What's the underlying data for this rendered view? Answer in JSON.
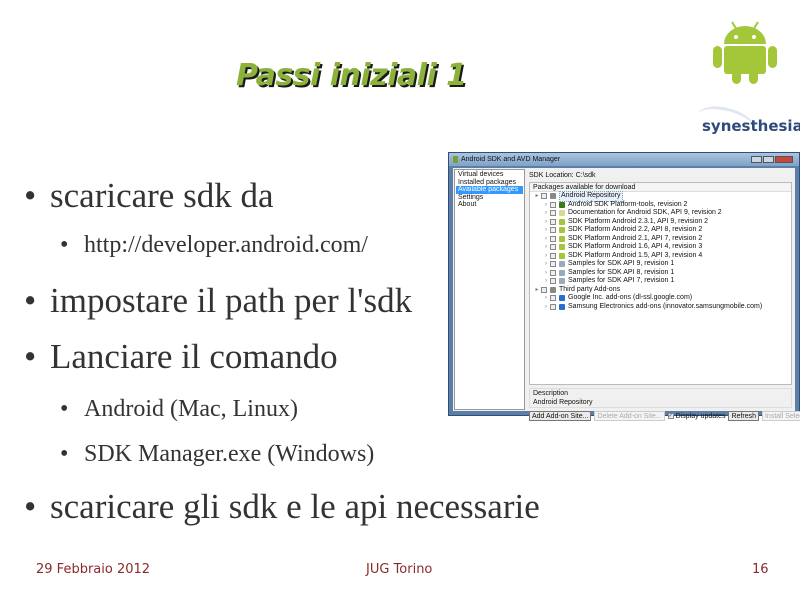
{
  "slide": {
    "title": "Passi iniziali 1",
    "bullets": [
      {
        "level": 1,
        "text": "scaricare sdk da"
      },
      {
        "level": 2,
        "text": "http://developer.android.com/"
      },
      {
        "level": 1,
        "text": "impostare il path per l'sdk"
      },
      {
        "level": 1,
        "text": "Lanciare il comando"
      },
      {
        "level": 2,
        "text": "Android (Mac, Linux)"
      },
      {
        "level": 2,
        "text": "SDK Manager.exe (Windows)"
      },
      {
        "level": 1,
        "text": "scaricare gli sdk e le api necessarie"
      }
    ],
    "bullet_char": "•",
    "footer": {
      "date": "29 Febbraio 2012",
      "event": "JUG Torino",
      "page": "16"
    },
    "logo": {
      "text": "synesthesia",
      "icon": "android-robot-icon",
      "android_color": "#a4c639"
    },
    "title_color": "#8db23c",
    "footer_color": "#8b2a2a"
  },
  "window": {
    "title": "Android SDK and AVD Manager",
    "nav": [
      "Virtual devices",
      "Installed packages",
      "Available packages",
      "Settings",
      "About"
    ],
    "selected_nav": "Available packages",
    "sdk_location": "SDK Location: C:\\sdk",
    "packages_header": "Packages available for download",
    "tree": [
      {
        "level": 0,
        "label": "Android Repository",
        "icon": "repository-icon"
      },
      {
        "level": 1,
        "label": "Android SDK Platform-tools, revision 2",
        "icon": "tools-icon"
      },
      {
        "level": 1,
        "label": "Documentation for Android SDK, API 9, revision 2",
        "icon": "document-icon"
      },
      {
        "level": 1,
        "label": "SDK Platform Android 2.3.1, API 9, revision 2",
        "icon": "android-icon"
      },
      {
        "level": 1,
        "label": "SDK Platform Android 2.2, API 8, revision 2",
        "icon": "android-icon"
      },
      {
        "level": 1,
        "label": "SDK Platform Android 2.1, API 7, revision 2",
        "icon": "android-icon"
      },
      {
        "level": 1,
        "label": "SDK Platform Android 1.6, API 4, revision 3",
        "icon": "android-icon"
      },
      {
        "level": 1,
        "label": "SDK Platform Android 1.5, API 3, revision 4",
        "icon": "android-icon"
      },
      {
        "level": 1,
        "label": "Samples for SDK API 9, revision 1",
        "icon": "flask-icon"
      },
      {
        "level": 1,
        "label": "Samples for SDK API 8, revision 1",
        "icon": "flask-icon"
      },
      {
        "level": 1,
        "label": "Samples for SDK API 7, revision 1",
        "icon": "flask-icon"
      },
      {
        "level": 0,
        "label": "Third party Add-ons",
        "icon": "repository-icon"
      },
      {
        "level": 1,
        "label": "Google Inc. add-ons (dl-ssl.google.com)",
        "icon": "globe-icon"
      },
      {
        "level": 1,
        "label": "Samsung Electronics add-ons (innovator.samsungmobile.com)",
        "icon": "globe-icon"
      }
    ],
    "description_label": "Description",
    "description_text": "Android Repository",
    "buttons": {
      "add_site": "Add Add-on Site...",
      "delete_site": "Delete Add-on Site...",
      "display_updates": "Display updates",
      "display_updates_checked": true,
      "refresh": "Refresh",
      "install": "Install Selected"
    }
  }
}
